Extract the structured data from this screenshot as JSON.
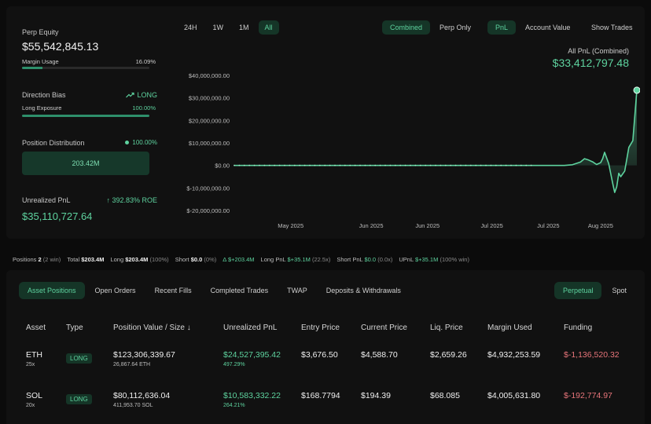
{
  "stats": {
    "perp_equity_label": "Perp Equity",
    "perp_equity_value": "$55,542,845.13",
    "margin_usage_label": "Margin Usage",
    "margin_usage_value": "16.09%",
    "margin_usage_fraction": 0.1609,
    "direction_bias_label": "Direction Bias",
    "direction_bias_value": "LONG",
    "long_exposure_label": "Long Exposure",
    "long_exposure_value": "100.00%",
    "long_exposure_fraction": 1.0,
    "position_distribution_label": "Position Distribution",
    "position_distribution_pct": "100.00%",
    "position_distribution_box": "203.42M",
    "unrealized_pnl_label": "Unrealized PnL",
    "unrealized_pnl_roe": "392.83% ROE",
    "unrealized_pnl_value": "$35,110,727.64"
  },
  "chart_controls": {
    "timeframes": [
      "24H",
      "1W",
      "1M",
      "All"
    ],
    "active_timeframe": "All",
    "modes": [
      "Combined",
      "Perp Only"
    ],
    "active_mode": "Combined",
    "views": [
      "PnL",
      "Account Value"
    ],
    "active_view": "PnL",
    "show_trades": "Show Trades"
  },
  "pnl_summary": {
    "label": "All PnL (Combined)",
    "value": "$33,412,797.48"
  },
  "chart_data": {
    "type": "area",
    "title": "",
    "xlabel": "",
    "ylabel": "",
    "yticks": [
      40000000,
      30000000,
      20000000,
      10000000,
      0,
      -10000000,
      -20000000
    ],
    "ytick_labels": [
      "$40,000,000.00",
      "$30,000,000.00",
      "$20,000,000.00",
      "$10,000,000.00",
      "$0.00",
      "$-10,000,000.00",
      "$-20,000,000.00"
    ],
    "ylim": [
      -20000000,
      40000000
    ],
    "xtick_labels": [
      "May 2025",
      "Jun 2025",
      "Jun 2025",
      "Jul 2025",
      "Jul 2025",
      "Aug 2025"
    ],
    "xtick_positions": [
      0.14,
      0.34,
      0.48,
      0.64,
      0.78,
      0.91
    ],
    "grid": false,
    "accent_color": "#5ed39f",
    "series": [
      {
        "x": [
          0,
          0.1,
          0.2,
          0.3,
          0.4,
          0.5,
          0.6,
          0.7,
          0.74,
          0.78,
          0.82,
          0.84,
          0.86,
          0.87,
          0.88,
          0.89,
          0.9,
          0.91,
          0.915,
          0.92,
          0.93,
          0.94,
          0.945,
          0.95,
          0.955,
          0.96,
          0.97,
          0.98,
          0.99,
          1.0
        ],
        "values": [
          0,
          0,
          0,
          0,
          0,
          0,
          0,
          0,
          0,
          0,
          0,
          300000,
          1500000,
          3000000,
          2400000,
          1600000,
          400000,
          1200000,
          3000000,
          5800000,
          800000,
          -8000000,
          -12000000,
          -9500000,
          -3500000,
          -5000000,
          -2500000,
          8000000,
          11000000,
          33412797.48
        ]
      }
    ]
  },
  "summary_strip": {
    "positions_label": "Positions",
    "positions_count": "2",
    "positions_win": "(2 win)",
    "total_label": "Total",
    "total_value": "$203.4M",
    "long_label": "Long",
    "long_value": "$203.4M",
    "long_pct": "(100%)",
    "short_label": "Short",
    "short_value": "$0.0",
    "short_pct": "(0%)",
    "delta_label": "Δ",
    "delta_value": "$+203.4M",
    "long_pnl_label": "Long PnL",
    "long_pnl_value": "$+35.1M",
    "long_pnl_mult": "(22.5x)",
    "short_pnl_label": "Short PnL",
    "short_pnl_value": "$0.0",
    "short_pnl_mult": "(0.0x)",
    "upnl_label": "UPnL",
    "upnl_value": "$+35.1M",
    "upnl_win": "(100% win)"
  },
  "tabs": {
    "items": [
      "Asset Positions",
      "Open Orders",
      "Recent Fills",
      "Completed Trades",
      "TWAP",
      "Deposits & Withdrawals"
    ],
    "active": "Asset Positions",
    "type_items": [
      "Perpetual",
      "Spot"
    ],
    "type_active": "Perpetual"
  },
  "table": {
    "headers": [
      "Asset",
      "Type",
      "Position Value / Size",
      "Unrealized PnL",
      "Entry Price",
      "Current Price",
      "Liq. Price",
      "Margin Used",
      "Funding"
    ],
    "sort_arrow": "↓",
    "rows": [
      {
        "asset": "ETH",
        "leverage": "25x",
        "type": "LONG",
        "position_value": "$123,306,339.67",
        "size": "26,867.64 ETH",
        "upnl": "$24,527,395.42",
        "upnl_pct": "497.29%",
        "entry": "$3,676.50",
        "current": "$4,588.70",
        "liq": "$2,659.26",
        "margin": "$4,932,253.59",
        "funding": "$-1,136,520.32"
      },
      {
        "asset": "SOL",
        "leverage": "20x",
        "type": "LONG",
        "position_value": "$80,112,636.04",
        "size": "411,953.70 SOL",
        "upnl": "$10,583,332.22",
        "upnl_pct": "264.21%",
        "entry": "$168.7794",
        "current": "$194.39",
        "liq": "$68.085",
        "margin": "$4,005,631.80",
        "funding": "$-192,774.97"
      }
    ]
  }
}
